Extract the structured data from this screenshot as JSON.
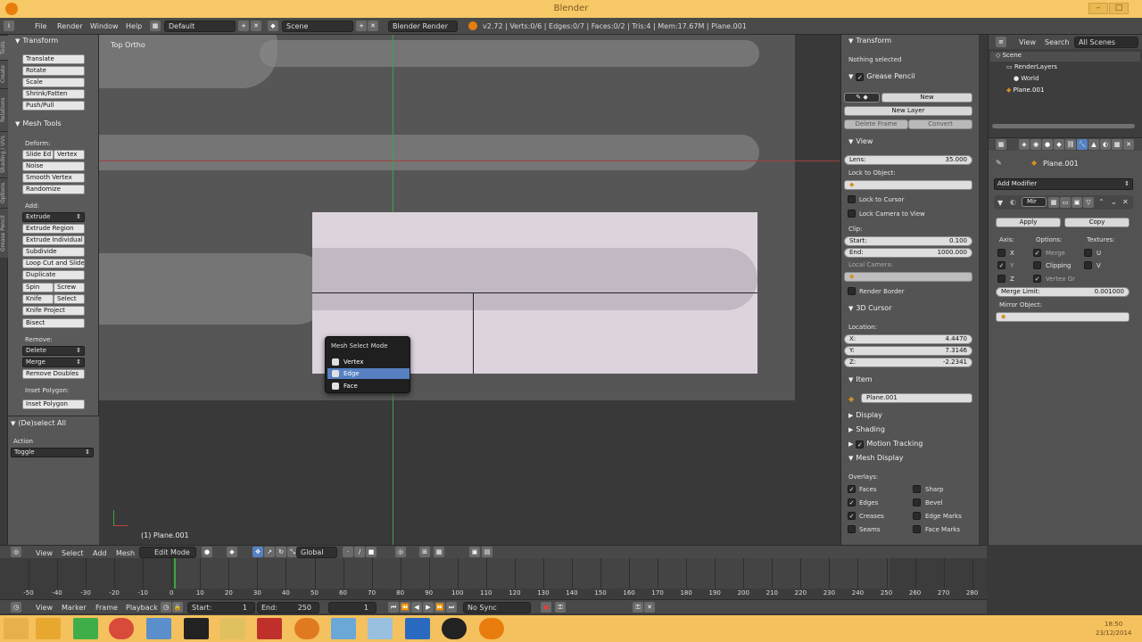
{
  "window": {
    "title": "Blender",
    "min": "–",
    "max": "□",
    "close": "✕"
  },
  "menubar": {
    "items": [
      "File",
      "Render",
      "Window",
      "Help"
    ],
    "layout": "Default",
    "scene": "Scene",
    "engine": "Blender Render",
    "stats": "v2.72 | Verts:0/6 | Edges:0/7 | Faces:0/2 | Tris:4 | Mem:17.67M | Plane.001"
  },
  "tabs": [
    "Tools",
    "Create",
    "Relations",
    "Shading / UVs",
    "Options",
    "Grease Pencil"
  ],
  "toolshelf": {
    "transform_header": "Transform",
    "transform": [
      "Translate",
      "Rotate",
      "Scale",
      "Shrink/Fatten",
      "Push/Pull"
    ],
    "mesh_tools_header": "Mesh Tools",
    "deform_label": "Deform:",
    "slide_edge": "Slide Ed",
    "vertex": "Vertex",
    "deform": [
      "Noise",
      "Smooth Vertex",
      "Randomize"
    ],
    "add_label": "Add:",
    "extrude": "Extrude",
    "add": [
      "Extrude Region",
      "Extrude Individual",
      "Subdivide",
      "Loop Cut and Slide",
      "Duplicate"
    ],
    "spin": "Spin",
    "screw": "Screw",
    "knife": "Knife",
    "select": "Select",
    "knife_project": "Knife Project",
    "bisect": "Bisect",
    "remove_label": "Remove:",
    "delete": "Delete",
    "merge": "Merge",
    "remove_doubles": "Remove Doubles",
    "inset_label": "Inset Polygon:",
    "inset": "Inset Polygon",
    "op_header": "(De)select All",
    "action_label": "Action",
    "action_value": "Toggle"
  },
  "viewport": {
    "view_label": "Top Ortho",
    "object_label": "(1) Plane.001"
  },
  "popup": {
    "title": "Mesh Select Mode",
    "items": [
      "Vertex",
      "Edge",
      "Face"
    ],
    "selected": "Edge"
  },
  "properties": {
    "transform_header": "Transform",
    "nothing_selected": "Nothing selected",
    "grease_header": "Grease Pencil",
    "new": "New",
    "new_layer": "New Layer",
    "delete_frame": "Delete Frame",
    "convert": "Convert",
    "view_header": "View",
    "lens_label": "Lens:",
    "lens_value": "35.000",
    "lock_label": "Lock to Object:",
    "lock_cursor": "Lock to Cursor",
    "lock_camera": "Lock Camera to View",
    "clip_label": "Clip:",
    "start_label": "Start:",
    "start_value": "0.100",
    "end_label": "End:",
    "end_value": "1000.000",
    "local_camera": "Local Camera:",
    "render_border": "Render Border",
    "cursor_header": "3D Cursor",
    "location_label": "Location:",
    "x_label": "X:",
    "x_value": "4.4470",
    "y_label": "Y:",
    "y_value": "7.3146",
    "z_label": "Z:",
    "z_value": "-2.2341",
    "item_header": "Item",
    "item_name": "Plane.001",
    "display": "Display",
    "shading": "Shading",
    "motion": "Motion Tracking",
    "mesh_display": "Mesh Display",
    "overlays": "Overlays:",
    "faces": "Faces",
    "sharp": "Sharp",
    "edges": "Edges",
    "bevel": "Bevel",
    "creases": "Creases",
    "edge_marks": "Edge Marks",
    "seams": "Seams",
    "face_marks": "Face Marks"
  },
  "outliner": {
    "view": "View",
    "search": "Search",
    "all_scenes": "All Scenes",
    "items": [
      "Scene",
      "RenderLayers",
      "World",
      "Plane.001"
    ]
  },
  "modifiers": {
    "object": "Plane.001",
    "add_modifier": "Add Modifier",
    "mod_name": "Mir",
    "apply": "Apply",
    "copy": "Copy",
    "axis": "Axis:",
    "options": "Options:",
    "textures": "Textures:",
    "x": "X",
    "y": "Y",
    "z": "Z",
    "merge": "Merge",
    "clipping": "Clipping",
    "vertex_gr": "Vertex Gr",
    "u": "U",
    "v": "V",
    "merge_limit_label": "Merge Limit:",
    "merge_limit_value": "0.001000",
    "mirror_object": "Mirror Object:"
  },
  "vpheader": {
    "view": "View",
    "select": "Select",
    "add": "Add",
    "mesh": "Mesh",
    "mode": "Edit Mode",
    "orientation": "Global"
  },
  "timeline": {
    "ticks": [
      "-50",
      "-40",
      "-30",
      "-20",
      "-10",
      "0",
      "10",
      "20",
      "30",
      "40",
      "50",
      "60",
      "70",
      "80",
      "90",
      "100",
      "110",
      "120",
      "130",
      "140",
      "150",
      "160",
      "170",
      "180",
      "190",
      "200",
      "210",
      "220",
      "230",
      "240",
      "250",
      "260",
      "270",
      "280"
    ],
    "current_frame": 1
  },
  "tlheader": {
    "view": "View",
    "marker": "Marker",
    "frame": "Frame",
    "playback": "Playback",
    "start_label": "Start:",
    "start": "1",
    "end_label": "End:",
    "end": "250",
    "current": "1",
    "sync": "No Sync"
  },
  "taskbar": {
    "time": "18:50",
    "date": "23/12/2014"
  },
  "colors": {
    "selection": "#5680c2",
    "titlebar": "#f6c866",
    "accent_green": "#3fa33f"
  }
}
